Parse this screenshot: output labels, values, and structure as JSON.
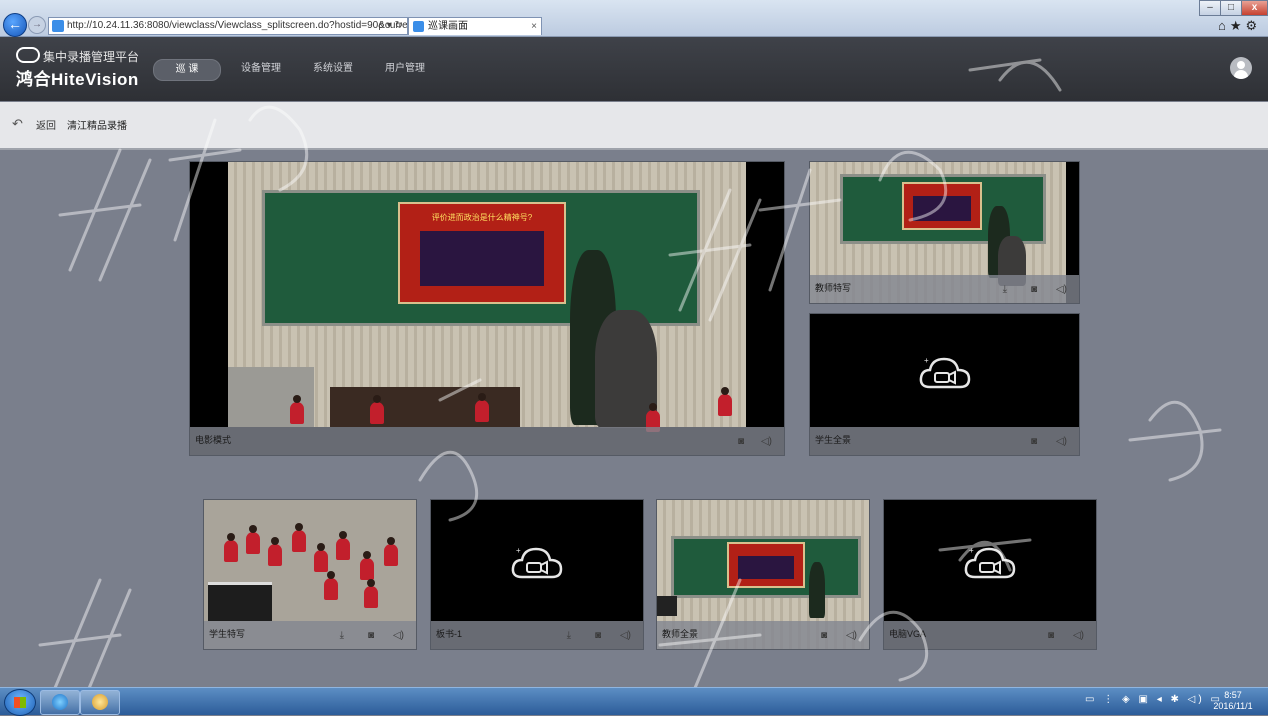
{
  "browser": {
    "url": "http://10.24.11.36:8080/viewclass/Viewclass_splitscreen.do?hostid=90&current?s",
    "url_tools": "ρ ▾ ↻",
    "tab_title": "巡课画面",
    "tab_close": "×",
    "min": "–",
    "max": "□",
    "close": "x",
    "right_icons": "⌂★⚙",
    "back": "←",
    "forward": "→"
  },
  "header": {
    "platform_name": "集中录播管理平台",
    "brand": "鸿合HiteVision",
    "nav": [
      {
        "label": "巡 课",
        "active": true
      },
      {
        "label": "设备管理",
        "active": false
      },
      {
        "label": "系统设置",
        "active": false
      },
      {
        "label": "用户管理",
        "active": false
      }
    ]
  },
  "subbar": {
    "back_icon": "↶",
    "back_label": "返回",
    "breadcrumb": "清江精品录播"
  },
  "tiles": {
    "main": {
      "label": "电影模式",
      "camera": "◙",
      "sound": "◁)"
    },
    "teacher_closeup": {
      "label": "教师特写",
      "download": "⤓",
      "camera": "◙",
      "sound": "◁)"
    },
    "student_panorama": {
      "label": "学生全景",
      "camera": "◙",
      "sound": "◁)"
    },
    "student_closeup": {
      "label": "学生特写",
      "download": "⤓",
      "camera": "◙",
      "sound": "◁)"
    },
    "blackboard": {
      "label": "板书-1",
      "download": "⤓",
      "camera": "◙",
      "sound": "◁)"
    },
    "teacher_panorama": {
      "label": "教师全景",
      "camera": "◙",
      "sound": "◁)"
    },
    "vga": {
      "label": "电脑VGA",
      "camera": "◙",
      "sound": "◁)"
    }
  },
  "scene": {
    "slide_title": "评价进而政治是什么精神号?"
  },
  "taskbar": {
    "tray_icons": "▭ ⋮ ◈ ▣ ◂ ✱ ◁) ▭",
    "time": "8:57",
    "date": "2016/11/1"
  },
  "colors": {
    "app_header": "#2e3035",
    "page_bg": "#7a7f8c",
    "tile_bg": "#000000",
    "slide_red": "#b22016"
  }
}
